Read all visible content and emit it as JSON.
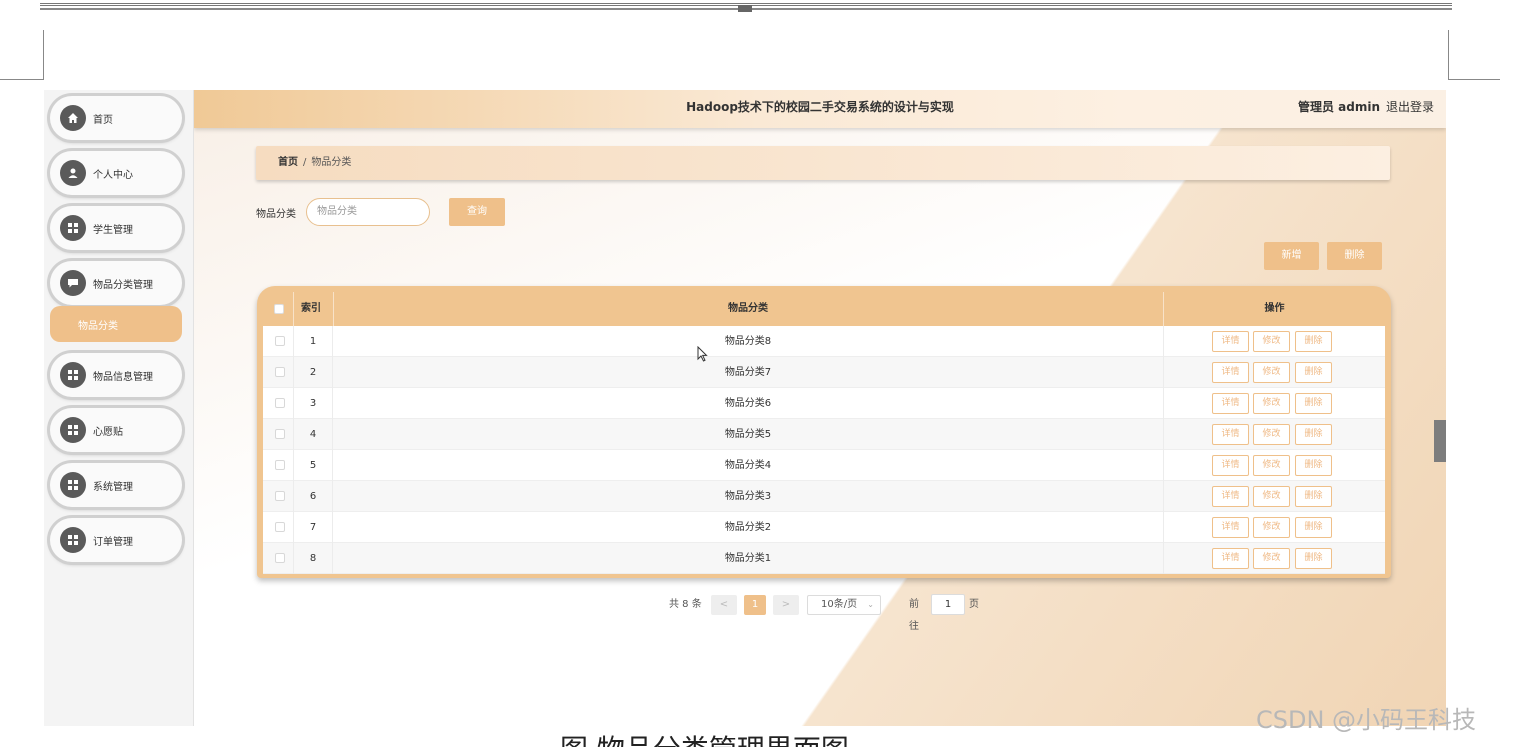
{
  "header": {
    "title": "Hadoop技术下的校园二手交易系统的设计与实现",
    "admin_label": "管理员 admin",
    "logout_label": "退出登录"
  },
  "sidebar": {
    "items": [
      {
        "label": "首页",
        "icon": "home-icon"
      },
      {
        "label": "个人中心",
        "icon": "user-icon"
      },
      {
        "label": "学生管理",
        "icon": "grid-icon"
      },
      {
        "label": "物品分类管理",
        "icon": "chat-icon"
      },
      {
        "label": "物品信息管理",
        "icon": "grid-icon"
      },
      {
        "label": "心愿贴",
        "icon": "grid-icon"
      },
      {
        "label": "系统管理",
        "icon": "grid-icon"
      },
      {
        "label": "订单管理",
        "icon": "grid-icon"
      }
    ],
    "active_sub": "物品分类"
  },
  "breadcrumb": {
    "home": "首页",
    "separator": "/",
    "current": "物品分类"
  },
  "search": {
    "label": "物品分类",
    "placeholder": "物品分类",
    "query_button": "查询"
  },
  "actions": {
    "add": "新增",
    "delete": "删除"
  },
  "table": {
    "headers": {
      "index": "索引",
      "category": "物品分类",
      "operation": "操作"
    },
    "rows": [
      {
        "index": "1",
        "category": "物品分类8"
      },
      {
        "index": "2",
        "category": "物品分类7"
      },
      {
        "index": "3",
        "category": "物品分类6"
      },
      {
        "index": "4",
        "category": "物品分类5"
      },
      {
        "index": "5",
        "category": "物品分类4"
      },
      {
        "index": "6",
        "category": "物品分类3"
      },
      {
        "index": "7",
        "category": "物品分类2"
      },
      {
        "index": "8",
        "category": "物品分类1"
      }
    ],
    "row_buttons": {
      "detail": "详情",
      "edit": "修改",
      "delete": "删除"
    }
  },
  "pagination": {
    "total": "共 8 条",
    "prev": "<",
    "current_page": "1",
    "next": ">",
    "page_size": "10条/页",
    "goto_label": "前往",
    "goto_value": "1",
    "page_suffix": "页"
  },
  "watermark": "CSDN @小码王科技",
  "caption": "图     物品分类管理界面图",
  "colors": {
    "accent": "#efc08a",
    "header_gradient_start": "#f0c996",
    "text": "#333333"
  }
}
